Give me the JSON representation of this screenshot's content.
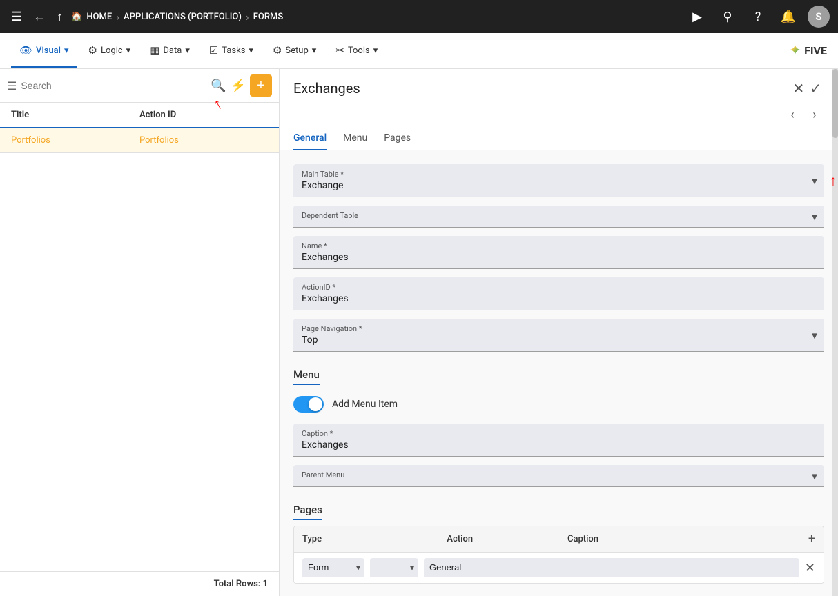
{
  "topnav": {
    "menu_icon": "☰",
    "back_icon": "←",
    "up_icon": "↑",
    "home_label": "HOME",
    "breadcrumb": [
      {
        "label": "HOME",
        "sep": "›"
      },
      {
        "label": "APPLICATIONS (PORTFOLIO)",
        "sep": "›"
      },
      {
        "label": "FORMS",
        "sep": ""
      }
    ],
    "play_icon": "▶",
    "search_icon": "🔍",
    "help_icon": "?",
    "bell_icon": "🔔",
    "avatar_label": "S"
  },
  "toolbar": {
    "tabs": [
      {
        "label": "Visual",
        "icon": "👁",
        "active": true
      },
      {
        "label": "Logic",
        "icon": "⚙"
      },
      {
        "label": "Data",
        "icon": "▦"
      },
      {
        "label": "Tasks",
        "icon": "☑"
      },
      {
        "label": "Setup",
        "icon": "⚙"
      },
      {
        "label": "Tools",
        "icon": "✂"
      }
    ]
  },
  "leftpanel": {
    "search_placeholder": "Search",
    "columns": [
      {
        "label": "Title"
      },
      {
        "label": "Action ID"
      }
    ],
    "rows": [
      {
        "title": "Portfolios",
        "action_id": "Portfolios"
      }
    ],
    "total_rows_label": "Total Rows: 1"
  },
  "rightpanel": {
    "title": "Exchanges",
    "tabs": [
      {
        "label": "General",
        "active": true
      },
      {
        "label": "Menu"
      },
      {
        "label": "Pages"
      }
    ],
    "fields": {
      "main_table_label": "Main Table *",
      "main_table_value": "Exchange",
      "dependent_table_label": "Dependent Table",
      "dependent_table_value": "",
      "name_label": "Name *",
      "name_value": "Exchanges",
      "action_id_label": "ActionID *",
      "action_id_value": "Exchanges",
      "page_nav_label": "Page Navigation *",
      "page_nav_value": "Top"
    },
    "menu_section": {
      "heading": "Menu",
      "toggle_label": "Add Menu Item",
      "caption_label": "Caption *",
      "caption_value": "Exchanges",
      "parent_menu_label": "Parent Menu"
    },
    "pages_section": {
      "heading": "Pages",
      "columns": [
        "Type",
        "Action",
        "Caption"
      ],
      "row": {
        "type_value": "Form",
        "action_value": "",
        "caption_value": "General"
      }
    }
  }
}
